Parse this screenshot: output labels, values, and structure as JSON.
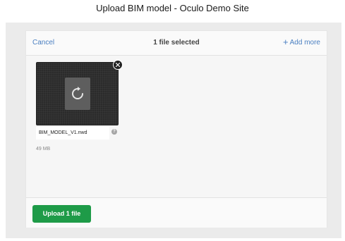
{
  "dialog": {
    "title": "Upload BIM model - Oculo Demo Site"
  },
  "uploader": {
    "cancel_label": "Cancel",
    "selected_text": "1 file selected",
    "add_more_icon": "+",
    "add_more_label": "Add more",
    "upload_button_label": "Upload 1 file",
    "accent_color": "#4a7fc1",
    "upload_color": "#1e9b48"
  },
  "files": [
    {
      "name": "BIM_MODEL_V1.nwd",
      "size": "49 MB",
      "icon": "file-refresh-icon",
      "remove_icon": "close-icon",
      "help_icon": "?"
    }
  ]
}
